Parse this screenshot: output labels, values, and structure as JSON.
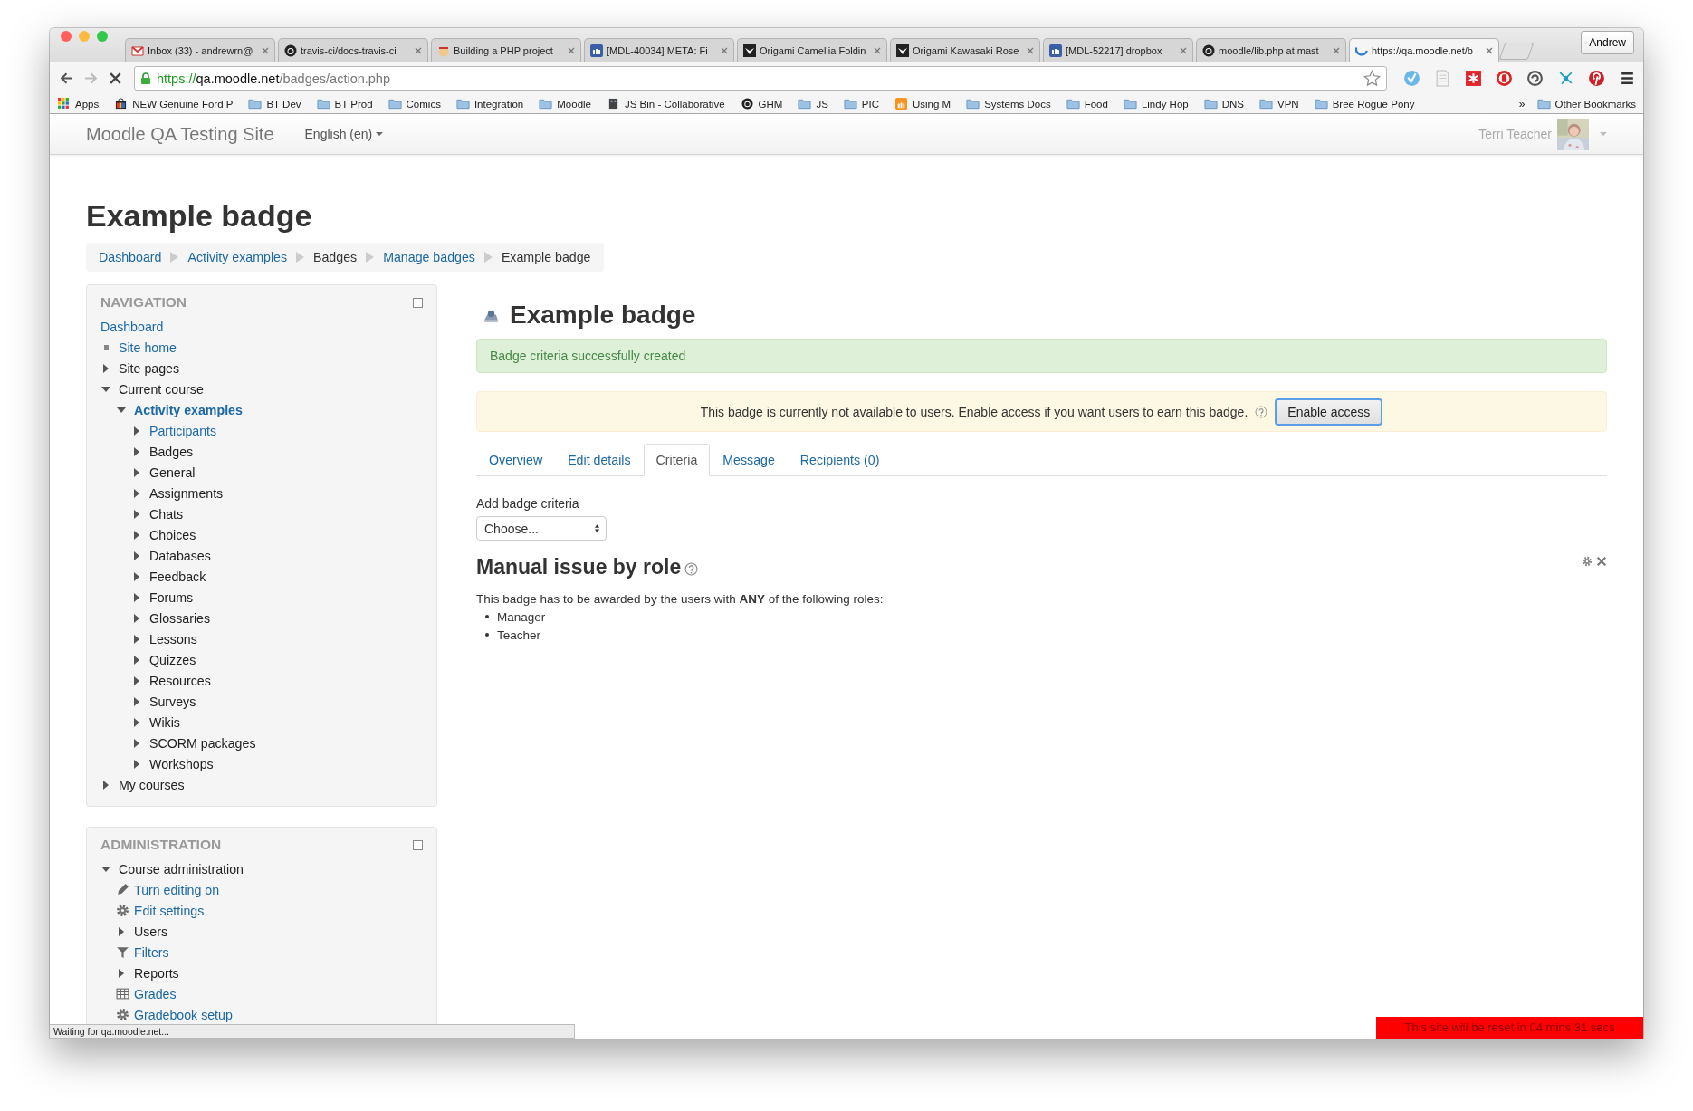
{
  "browser": {
    "tabs": [
      {
        "title": "Inbox (33) - andrewrn@",
        "kind": "mail",
        "selected": false
      },
      {
        "title": "travis-ci/docs-travis-ci",
        "kind": "github",
        "selected": false
      },
      {
        "title": "Building a PHP project",
        "kind": "mascot",
        "selected": false
      },
      {
        "title": "[MDL-40034] META: Fi",
        "kind": "tracker",
        "selected": false
      },
      {
        "title": "Origami Camellia Foldin",
        "kind": "origami",
        "selected": false
      },
      {
        "title": "Origami Kawasaki Rose",
        "kind": "origami",
        "selected": false
      },
      {
        "title": "[MDL-52217] dropbox",
        "kind": "tracker",
        "selected": false
      },
      {
        "title": "moodle/lib.php at mast",
        "kind": "github",
        "selected": false
      },
      {
        "title": "https://qa.moodle.net/b",
        "kind": "spinner",
        "selected": true
      }
    ],
    "profile": "Andrew",
    "url": {
      "scheme": "https://",
      "host": "qa.moodle.net",
      "path": "/badges/action.php"
    },
    "bookmarks": [
      {
        "label": "Apps",
        "kind": "apps"
      },
      {
        "label": "NEW Genuine Ford P",
        "kind": "bag"
      },
      {
        "label": "BT Dev",
        "kind": "folder"
      },
      {
        "label": "BT Prod",
        "kind": "folder"
      },
      {
        "label": "Comics",
        "kind": "folder"
      },
      {
        "label": "Integration",
        "kind": "folder"
      },
      {
        "label": "Moodle",
        "kind": "folder"
      },
      {
        "label": "JS Bin - Collaborative",
        "kind": "jsbin"
      },
      {
        "label": "GHM",
        "kind": "github"
      },
      {
        "label": "JS",
        "kind": "folder"
      },
      {
        "label": "PIC",
        "kind": "folder"
      },
      {
        "label": "Using M",
        "kind": "moodle"
      },
      {
        "label": "Systems Docs",
        "kind": "folder"
      },
      {
        "label": "Food",
        "kind": "folder"
      },
      {
        "label": "Lindy Hop",
        "kind": "folder"
      },
      {
        "label": "DNS",
        "kind": "folder"
      },
      {
        "label": "VPN",
        "kind": "folder"
      },
      {
        "label": "Bree Rogue Pony",
        "kind": "folder"
      }
    ],
    "bookmarks_more": "»",
    "other_bookmarks": "Other Bookmarks",
    "status": "Waiting for qa.moodle.net..."
  },
  "site": {
    "name": "Moodle QA Testing Site",
    "language": "English (en)",
    "user": "Terri Teacher"
  },
  "page_title": "Example badge",
  "breadcrumb": [
    {
      "label": "Dashboard",
      "link": true
    },
    {
      "label": "Activity examples",
      "link": true
    },
    {
      "label": "Badges",
      "link": false
    },
    {
      "label": "Manage badges",
      "link": true
    },
    {
      "label": "Example badge",
      "link": false
    }
  ],
  "navigation": {
    "title": "NAVIGATION",
    "items": [
      {
        "label": "Dashboard",
        "link": true
      },
      {
        "label": "Site home",
        "link": true,
        "kind": "bullet"
      },
      {
        "label": "Site pages",
        "link": false,
        "expanded": false
      },
      {
        "label": "Current course",
        "link": false,
        "expanded": true,
        "children": [
          {
            "label": "Activity examples",
            "link": true,
            "current": true,
            "expanded": true,
            "children": [
              {
                "label": "Participants",
                "link": true,
                "expanded": false
              },
              {
                "label": "Badges",
                "link": false,
                "expanded": false
              },
              {
                "label": "General",
                "link": false,
                "expanded": false
              },
              {
                "label": "Assignments",
                "link": false,
                "expanded": false
              },
              {
                "label": "Chats",
                "link": false,
                "expanded": false
              },
              {
                "label": "Choices",
                "link": false,
                "expanded": false
              },
              {
                "label": "Databases",
                "link": false,
                "expanded": false
              },
              {
                "label": "Feedback",
                "link": false,
                "expanded": false
              },
              {
                "label": "Forums",
                "link": false,
                "expanded": false
              },
              {
                "label": "Glossaries",
                "link": false,
                "expanded": false
              },
              {
                "label": "Lessons",
                "link": false,
                "expanded": false
              },
              {
                "label": "Quizzes",
                "link": false,
                "expanded": false
              },
              {
                "label": "Resources",
                "link": false,
                "expanded": false
              },
              {
                "label": "Surveys",
                "link": false,
                "expanded": false
              },
              {
                "label": "Wikis",
                "link": false,
                "expanded": false
              },
              {
                "label": "SCORM packages",
                "link": false,
                "expanded": false
              },
              {
                "label": "Workshops",
                "link": false,
                "expanded": false
              }
            ]
          }
        ]
      },
      {
        "label": "My courses",
        "link": false,
        "expanded": false
      }
    ]
  },
  "administration": {
    "title": "ADMINISTRATION",
    "items": [
      {
        "label": "Course administration",
        "link": false,
        "expanded": true,
        "children": [
          {
            "label": "Turn editing on",
            "link": true,
            "kind": "pencil"
          },
          {
            "label": "Edit settings",
            "link": true,
            "kind": "gear"
          },
          {
            "label": "Users",
            "link": false,
            "expanded": false
          },
          {
            "label": "Filters",
            "link": true,
            "kind": "funnel"
          },
          {
            "label": "Reports",
            "link": false,
            "expanded": false
          },
          {
            "label": "Grades",
            "link": true,
            "kind": "table"
          },
          {
            "label": "Gradebook setup",
            "link": true,
            "kind": "gear"
          }
        ]
      }
    ]
  },
  "main": {
    "heading": "Example badge",
    "success": "Badge criteria successfully created",
    "warning": "This badge is currently not available to users. Enable access if you want users to earn this badge.",
    "enable_button": "Enable access",
    "tabs": [
      {
        "label": "Overview",
        "selected": false
      },
      {
        "label": "Edit details",
        "selected": false
      },
      {
        "label": "Criteria",
        "selected": true
      },
      {
        "label": "Message",
        "selected": false
      },
      {
        "label": "Recipients (0)",
        "selected": false
      }
    ],
    "add_label": "Add badge criteria",
    "select": "Choose...",
    "criterion": {
      "title": "Manual issue by role",
      "text": "This badge has to be awarded by the users with **ANY** of the following roles:",
      "roles": [
        "Manager",
        "Teacher"
      ]
    }
  },
  "reset_notice": "This site will be reset in 04 mins 31 secs"
}
